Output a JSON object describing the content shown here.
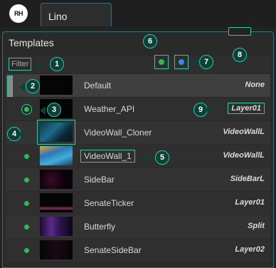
{
  "app": {
    "logo_text": "RH",
    "tab_label": "Lino"
  },
  "panel": {
    "title": "Templates",
    "filter_label": "Filter"
  },
  "toolbar": {
    "green_dot_color": "#35b65a",
    "blue_dot_color": "#2f8fe8"
  },
  "callouts": [
    "1",
    "2",
    "3",
    "4",
    "5",
    "6",
    "7",
    "8",
    "9"
  ],
  "rows": [
    {
      "name": "Default",
      "layer": "None",
      "status": false
    },
    {
      "name": "Weather_API",
      "layer": "Layer01",
      "status": true
    },
    {
      "name": "VideoWall_Cloner",
      "layer": "VideoWallL",
      "status": false
    },
    {
      "name": "VideoWall_1",
      "layer": "VideoWallL",
      "status": true
    },
    {
      "name": "SideBar",
      "layer": "SideBarL",
      "status": true
    },
    {
      "name": "SenateTicker",
      "layer": "Layer01",
      "status": true
    },
    {
      "name": "Butterfly",
      "layer": "Split",
      "status": true
    },
    {
      "name": "SenateSideBar",
      "layer": "Layer02",
      "status": true
    }
  ]
}
